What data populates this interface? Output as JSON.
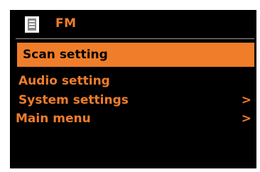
{
  "header": {
    "title": "FM",
    "icon": "fm-radio-icon"
  },
  "colors": {
    "accent": "#f07d2a",
    "background": "#000000",
    "divider": "#9a9a9a"
  },
  "menu": {
    "items": [
      {
        "label": "Scan setting",
        "arrow": "",
        "selected": true
      },
      {
        "label": "Audio setting",
        "arrow": "",
        "selected": false
      },
      {
        "label": "System settings",
        "arrow": ">",
        "selected": false
      },
      {
        "label": "Main menu",
        "arrow": ">",
        "selected": false
      }
    ]
  }
}
